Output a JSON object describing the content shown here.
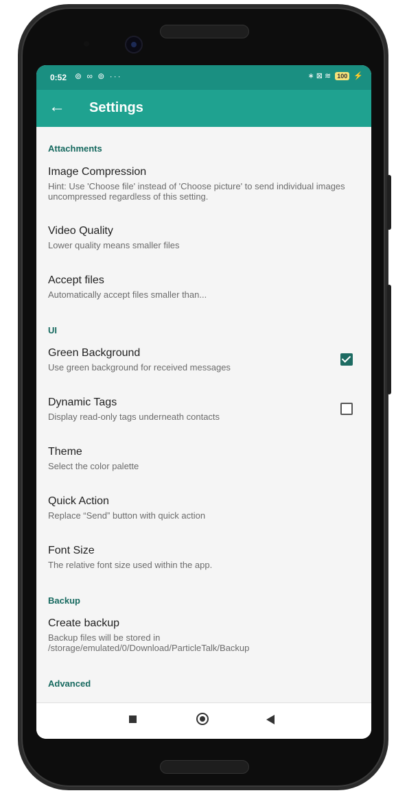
{
  "status_bar": {
    "time": "0:52",
    "left_icons": "⊚ ∞ ⊚ ···",
    "right_icons": "∗ ⊠ ≋",
    "battery": "100",
    "charging": "⚡"
  },
  "app_bar": {
    "back_icon": "arrow-left",
    "title": "Settings"
  },
  "sections": {
    "attachments": "Attachments",
    "ui": "UI",
    "backup": "Backup",
    "advanced": "Advanced"
  },
  "items": {
    "image_compression": {
      "title": "Image Compression",
      "summary": "Hint: Use 'Choose file' instead of 'Choose picture' to send individual images uncompressed regardless of this setting."
    },
    "video_quality": {
      "title": "Video Quality",
      "summary": "Lower quality means smaller files"
    },
    "accept_files": {
      "title": "Accept files",
      "summary": "Automatically accept files smaller than..."
    },
    "green_background": {
      "title": "Green Background",
      "summary": "Use green background for received messages",
      "checked": true
    },
    "dynamic_tags": {
      "title": "Dynamic Tags",
      "summary": "Display read-only tags underneath contacts",
      "checked": false
    },
    "theme": {
      "title": "Theme",
      "summary": "Select the color palette"
    },
    "quick_action": {
      "title": "Quick Action",
      "summary": "Replace “Send” button with quick action"
    },
    "font_size": {
      "title": "Font Size",
      "summary": "The relative font size used within the app."
    },
    "create_backup": {
      "title": "Create backup",
      "summary": "Backup files will be stored in /storage/emulated/0/Download/ParticleTalk/Backup"
    }
  },
  "nav_bar": {
    "recents_icon": "square-icon",
    "home_icon": "circle-icon",
    "back_icon": "triangle-icon"
  },
  "colors": {
    "status_bar": "#1a8f81",
    "app_bar": "#1fa290",
    "section_header": "#16695f",
    "checkbox": "#1d6b62"
  }
}
